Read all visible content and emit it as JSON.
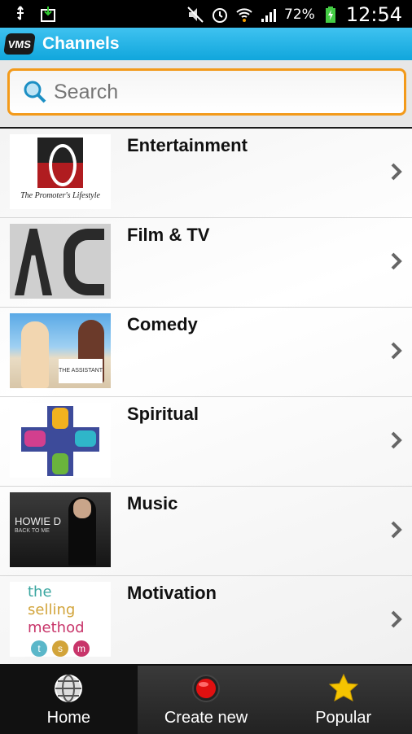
{
  "status": {
    "battery": "72%",
    "time": "12:54"
  },
  "appbar": {
    "logo": "VMS",
    "title": "Channels"
  },
  "search": {
    "placeholder": "Search"
  },
  "channels": [
    {
      "label": "Entertainment"
    },
    {
      "label": "Film & TV"
    },
    {
      "label": "Comedy"
    },
    {
      "label": "Spiritual"
    },
    {
      "label": "Music"
    },
    {
      "label": "Motivation"
    }
  ],
  "thumbs": {
    "entertainment": "The Promoter's Lifestyle",
    "comedy": "THE ASSISTANT",
    "music_title": "HOWIE D",
    "music_sub": "BACK TO ME",
    "motivation_1": "the",
    "motivation_2": "selling",
    "motivation_3": "method",
    "motivation_badges": [
      "t",
      "s",
      "m"
    ]
  },
  "tabs": [
    {
      "label": "Home"
    },
    {
      "label": "Create new"
    },
    {
      "label": "Popular"
    }
  ],
  "colors": {
    "accent": "#10a6dc",
    "search_border": "#f39a1a",
    "record": "#e01010",
    "star": "#f5c400"
  }
}
